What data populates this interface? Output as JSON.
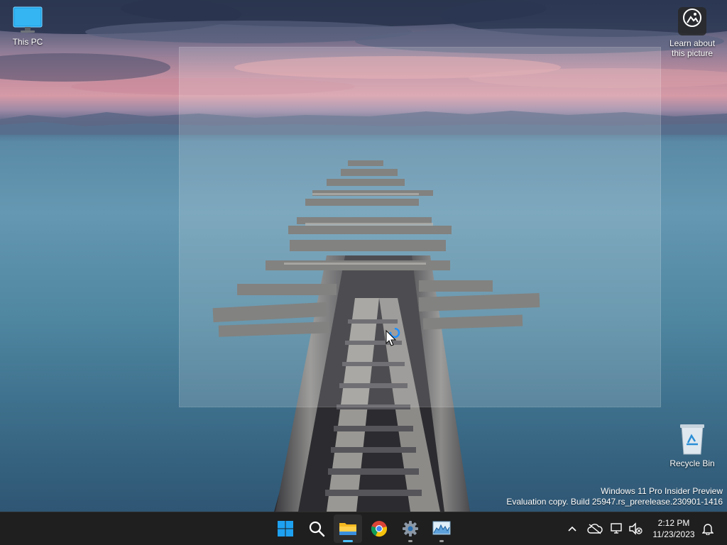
{
  "desktop_icons": {
    "this_pc": {
      "label": "This PC",
      "icon": "monitor-icon"
    },
    "learn": {
      "label_line1": "Learn about",
      "label_line2": "this picture",
      "icon": "learn-about-picture-icon"
    },
    "recycle_bin": {
      "label": "Recycle Bin",
      "icon": "recycle-bin-icon"
    }
  },
  "watermark": {
    "line1": "Windows 11 Pro Insider Preview",
    "line2": "Evaluation copy. Build 25947.rs_prerelease.230901-1416"
  },
  "taskbar": {
    "pinned": [
      {
        "name": "Start",
        "icon": "windows-logo-icon"
      },
      {
        "name": "Search",
        "icon": "search-icon"
      },
      {
        "name": "File Explorer",
        "icon": "folder-icon",
        "active": true
      },
      {
        "name": "Google Chrome",
        "icon": "chrome-icon"
      },
      {
        "name": "Settings",
        "icon": "gear-icon"
      },
      {
        "name": "Resource Monitor",
        "icon": "performance-chart-icon"
      }
    ],
    "tray": {
      "time": "2:12 PM",
      "date": "11/23/2023"
    }
  },
  "colors": {
    "taskbar_bg": "#1f1f1f",
    "accent": "#4cc2ff",
    "selection_overlay": "rgba(255,255,255,0.16)"
  }
}
